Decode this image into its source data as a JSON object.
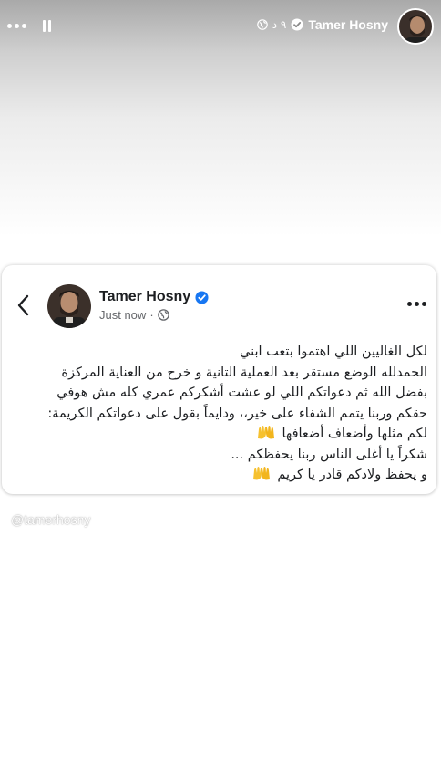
{
  "story": {
    "header": {
      "author_name": "Tamer Hosny",
      "time": "٩ د",
      "icons": [
        "avatar",
        "verified-badge-icon",
        "globe-icon",
        "pause-icon",
        "more-dots-icon"
      ]
    }
  },
  "post": {
    "author_name": "Tamer Hosny",
    "timestamp": "Just now",
    "separator": "·",
    "icons": [
      "back-chevron-icon",
      "verified-badge-icon",
      "globe-icon",
      "more-dots-icon",
      "raising-hands-emoji"
    ],
    "lines": [
      "لكل الغاليين اللي اهتموا بتعب ابني",
      "الحمدلله الوضع مستقر بعد العملية التانية و خرج من العناية المركزة",
      "بفضل الله ثم دعواتكم اللي لو عشت أشكركم عمري كله مش هوفي",
      "حقكم وربنا يتمم الشفاء على خير،، ودايماً بقول على دعواتكم الكريمة:",
      "لكم مثلها وأضعاف أضعافها",
      "شكراً يا أغلى الناس ربنا يحفظكم ...",
      "و يحفظ ولادكم قادر يا كريم"
    ]
  },
  "watermark": "@tamerhosny",
  "colors": {
    "verified_badge": "#1877f2",
    "text_primary": "#1c1e21",
    "text_secondary": "#65676b",
    "emoji": "#f6c12f"
  }
}
